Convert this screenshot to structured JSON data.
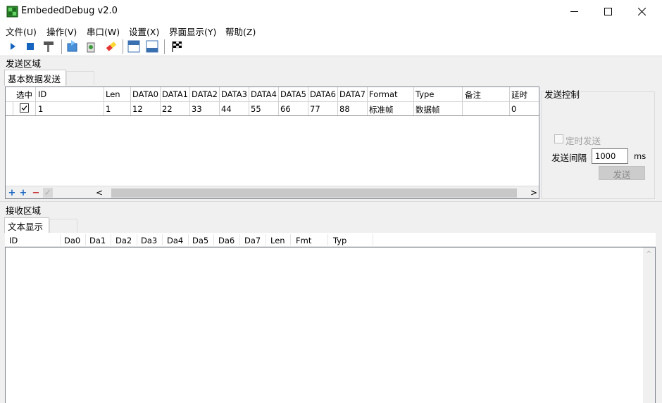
{
  "window": {
    "title": "EmbededDebug v2.0"
  },
  "menu": [
    "文件(U)",
    "操作(V)",
    "串口(W)",
    "设置(X)",
    "界面显示(Y)",
    "帮助(Z)"
  ],
  "send_area": {
    "label": "发送区域",
    "tab_active": "基本数据发送",
    "columns": [
      "选中",
      "ID",
      "Len",
      "DATA0",
      "DATA1",
      "DATA2",
      "DATA3",
      "DATA4",
      "DATA5",
      "DATA6",
      "DATA7",
      "Format",
      "Type",
      "备注",
      "延时"
    ],
    "rows": [
      {
        "selected": true,
        "id": "1",
        "len": "1",
        "d0": "12",
        "d1": "22",
        "d2": "33",
        "d3": "44",
        "d4": "55",
        "d5": "66",
        "d6": "77",
        "d7": "88",
        "format": "标准帧",
        "type": "数据帧",
        "note": "",
        "delay": "0"
      }
    ],
    "bottom_buttons": [
      "+",
      "+",
      "−",
      "✓"
    ]
  },
  "send_control": {
    "title": "发送控制",
    "timer_label": "定时发送",
    "interval_label": "发送间隔",
    "interval_value": "1000",
    "unit": "ms",
    "send_button": "发送"
  },
  "receive_area": {
    "label": "接收区域",
    "tab_active": "文本显示",
    "columns": [
      "ID",
      "Da0",
      "Da1",
      "Da2",
      "Da3",
      "Da4",
      "Da5",
      "Da6",
      "Da7",
      "Len",
      "Fmt",
      "Typ"
    ]
  },
  "colors": {
    "accent_blue": "#1565c0",
    "remove_red": "#c62828",
    "add_green": "#2e7d32"
  }
}
